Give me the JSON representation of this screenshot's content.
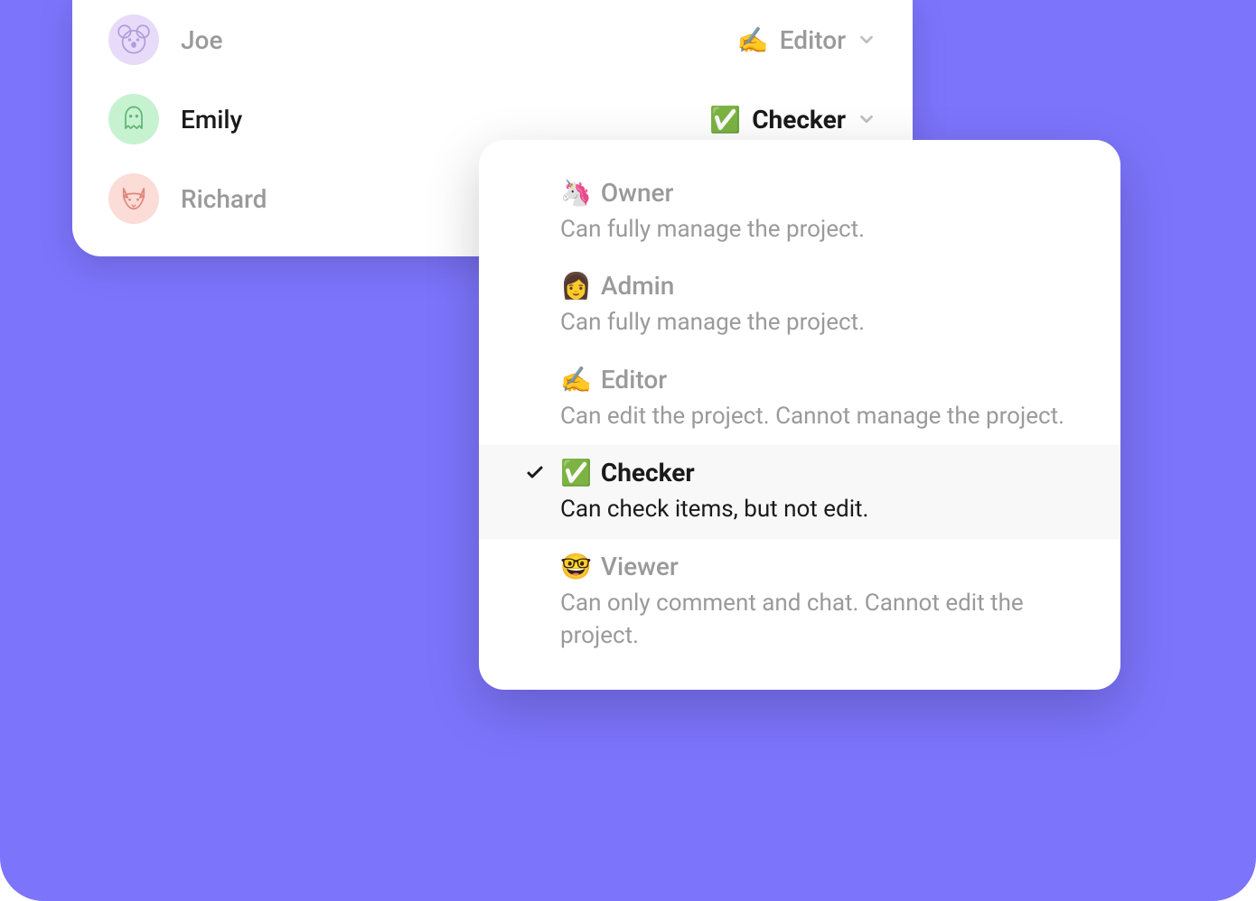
{
  "members": [
    {
      "name": "Joe",
      "role_emoji": "✍️",
      "role_label": "Editor",
      "faded": true,
      "avatar": "koala"
    },
    {
      "name": "Emily",
      "role_emoji": "✅",
      "role_label": "Checker",
      "faded": false,
      "avatar": "ghost"
    },
    {
      "name": "Richard",
      "role_emoji": "",
      "role_label": "",
      "faded": true,
      "avatar": "fox"
    }
  ],
  "dropdown": {
    "items": [
      {
        "emoji": "🦄",
        "label": "Owner",
        "desc": "Can fully manage the project.",
        "selected": false
      },
      {
        "emoji": "👩",
        "label": "Admin",
        "desc": "Can fully manage the project.",
        "selected": false
      },
      {
        "emoji": "✍️",
        "label": "Editor",
        "desc": "Can edit the project. Cannot manage the project.",
        "selected": false
      },
      {
        "emoji": "✅",
        "label": "Checker",
        "desc": "Can check items, but not edit.",
        "selected": true
      },
      {
        "emoji": "🤓",
        "label": "Viewer",
        "desc": "Can only comment and chat. Cannot edit the project.",
        "selected": false
      }
    ]
  }
}
